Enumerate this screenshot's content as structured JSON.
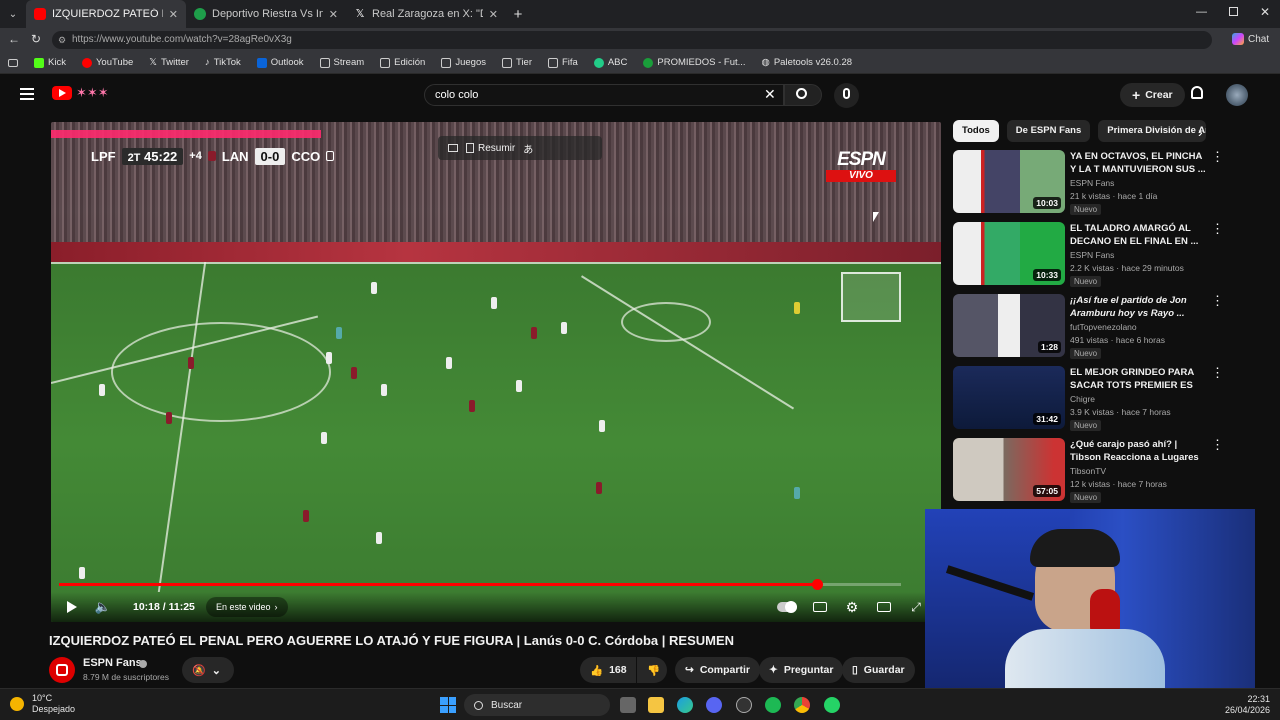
{
  "browser": {
    "tabs": [
      {
        "title": "IZQUIERDOZ PATEÓ EL PENAL",
        "active": true,
        "favicon": "youtube-icon"
      },
      {
        "title": "Deportivo Riestra Vs Independiente",
        "active": false,
        "favicon": "green-circle-icon"
      },
      {
        "title": "Real Zaragoza en X: \"Declaraciones",
        "active": false,
        "favicon": "x-icon"
      }
    ],
    "url": "https://www.youtube.com/watch?v=28agRe0vX3g",
    "chat_label": "Chat",
    "bookmarks": [
      "Kick",
      "YouTube",
      "Twitter",
      "TikTok",
      "Outlook",
      "Stream",
      "Edición",
      "Juegos",
      "Tier",
      "Fifa",
      "ABC",
      "PROMIEDOS - Fut...",
      "Paletools v26.0.28"
    ]
  },
  "youtube": {
    "search_value": "colo colo",
    "create_label": "Crear"
  },
  "video": {
    "scorebug": {
      "league": "LPF",
      "half": "2T",
      "clock": "45:22",
      "added": "+4",
      "home": "LAN",
      "score": "0-0",
      "away": "CCO"
    },
    "broadcaster": "ESPN",
    "live_label": "VIVO",
    "summarize_label": "Resumir",
    "time_current": "10:18",
    "time_total": "11:25",
    "time_display": "10:18 / 11:25",
    "chapter_label": "En este video",
    "progress": 0.9
  },
  "info": {
    "title": "IZQUIERDOZ PATEÓ EL PENAL PERO AGUERRE LO ATAJÓ Y FUE FIGURA | Lanús 0-0 C. Córdoba | RESUMEN",
    "channel": "ESPN Fans",
    "subscribers": "8.79 M de suscriptores",
    "likes": "168",
    "share_label": "Compartir",
    "ask_label": "Preguntar",
    "save_label": "Guardar"
  },
  "sidebar": {
    "chips": [
      "Todos",
      "De ESPN Fans",
      "Primera División de Arg"
    ],
    "videos": [
      {
        "title": "YA EN OCTAVOS, EL PINCHA Y LA T MANTUVIERON SUS ...",
        "channel": "ESPN Fans",
        "meta": "21 k vistas · hace 1 día",
        "badge": "Nuevo",
        "duration": "10:03"
      },
      {
        "title": "EL TALADRO AMARGÓ AL DECANO EN EL FINAL EN ...",
        "channel": "ESPN Fans",
        "meta": "2.2 K vistas · hace 29 minutos",
        "badge": "Nuevo",
        "duration": "10:33"
      },
      {
        "title": "¡¡Así fue el partido de Jon Aramburu hoy vs Rayo ...",
        "channel": "futTopvenezolano",
        "meta": "491 vistas · hace 6 horas",
        "badge": "Nuevo",
        "duration": "1:28"
      },
      {
        "title": "EL MEJOR GRINDEO PARA SACAR TOTS PREMIER ES UN...",
        "channel": "Chigre",
        "meta": "3.9 K vistas · hace 7 horas",
        "badge": "Nuevo",
        "duration": "31:42"
      },
      {
        "title": "¿Qué carajo pasó ahí? | Tibson Reacciona a Lugares Siniestros",
        "channel": "TibsonTV",
        "meta": "12 k vistas · hace 7 horas",
        "badge": "Nuevo",
        "duration": "57:05"
      }
    ]
  },
  "taskbar": {
    "weather_temp": "10°C",
    "weather_desc": "Despejado",
    "search_label": "Buscar",
    "time": "22:31",
    "date": "26/04/2026"
  },
  "colors": {
    "accent": "#ff0000",
    "bg": "#0f0f0f",
    "chip": "#272727"
  }
}
